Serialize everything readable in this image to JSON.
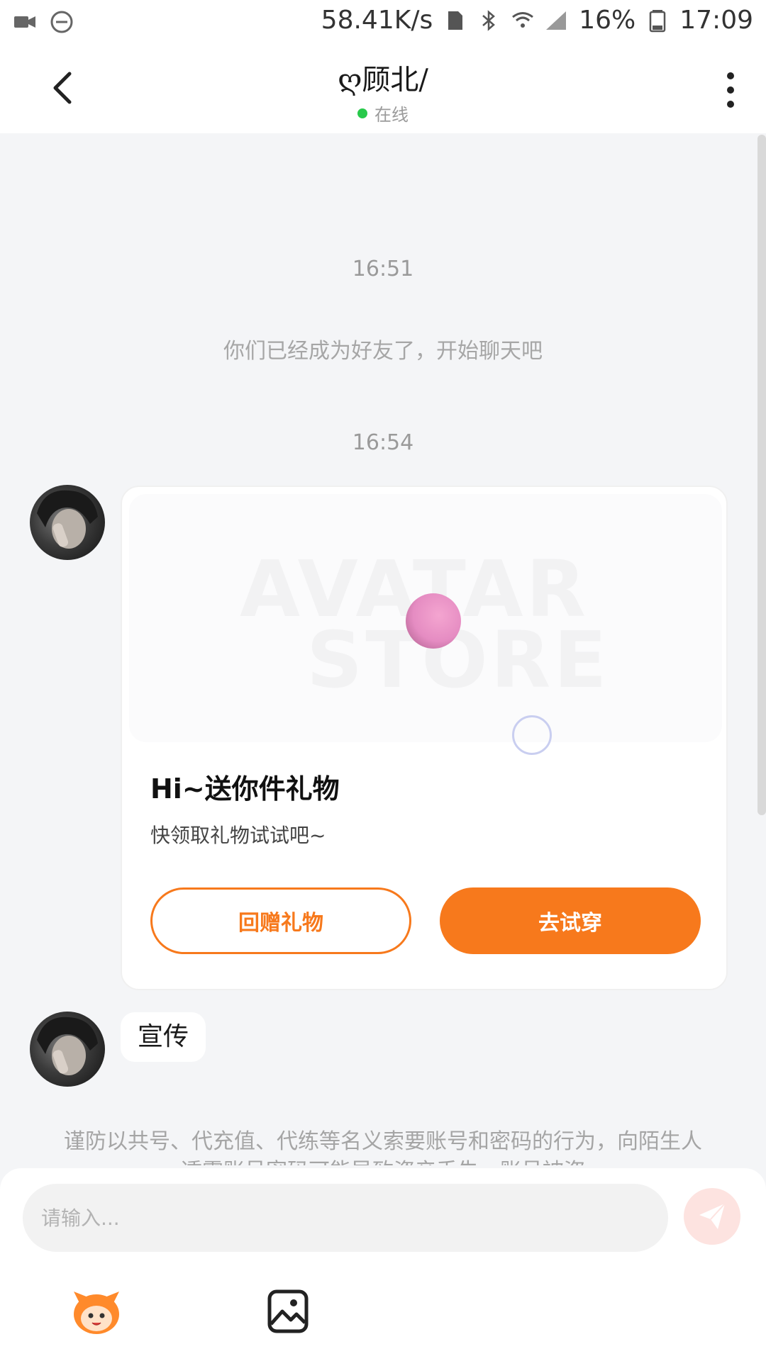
{
  "status_bar": {
    "network_speed": "58.41K/s",
    "battery": "16%",
    "time": "17:09"
  },
  "header": {
    "contact_name": "ღ顾北/",
    "status": "在线"
  },
  "messages": {
    "time1": "16:51",
    "system_friend": "你们已经成为好友了，开始聊天吧",
    "time2": "16:54",
    "gift_card": {
      "title": "Hi~送你件礼物",
      "subtitle": "快领取礼物试试吧~",
      "return_gift_label": "回赠礼物",
      "try_on_label": "去试穿",
      "watermark_line1": "AVATAR",
      "watermark_line2": "STORE"
    },
    "text_bubble": "宣传",
    "warning": "谨防以共号、代充值、代练等名义索要账号和密码的行为，向陌生人透露账号密码可能导致资产丢失、账号被盗"
  },
  "input": {
    "placeholder": "请输入..."
  },
  "colors": {
    "accent": "#f7791c",
    "online": "#28c94b",
    "send_bg": "#fde3e0"
  }
}
